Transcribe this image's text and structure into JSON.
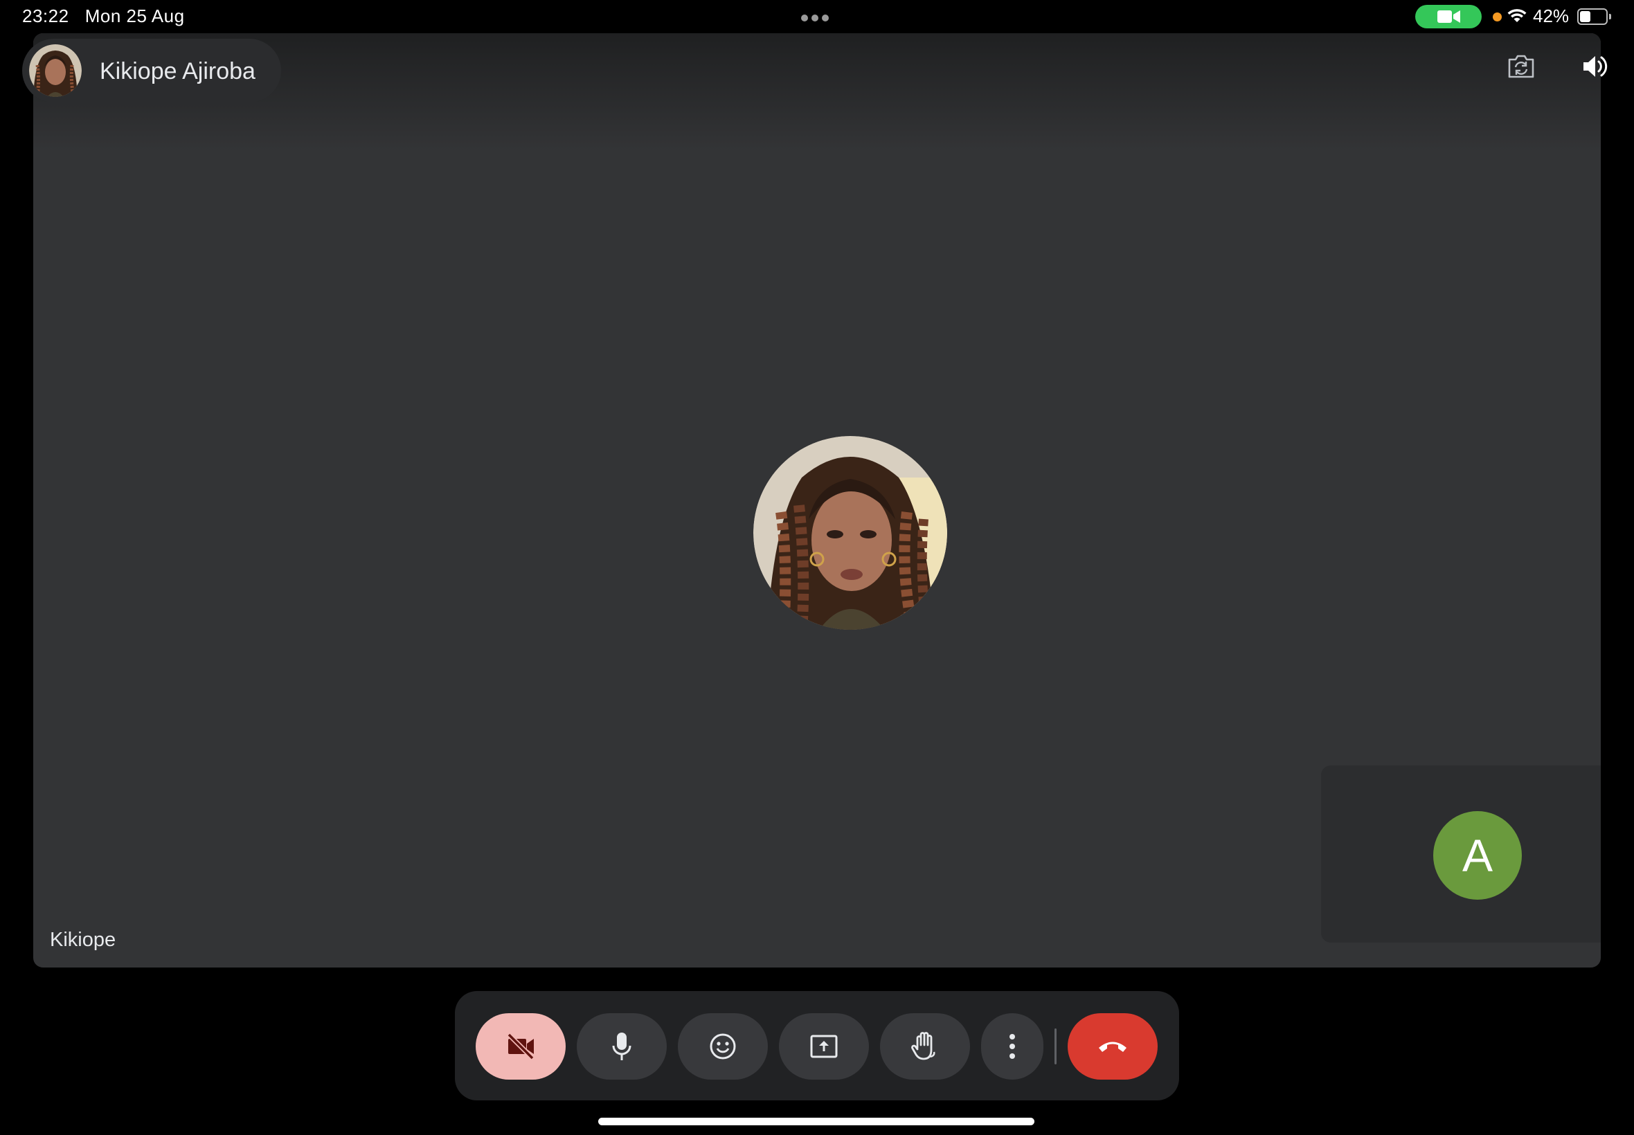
{
  "status_bar": {
    "time": "23:22",
    "date": "Mon 25 Aug",
    "battery_percent": "42%",
    "battery_level": 0.42,
    "camera_indicator_icon": "video-camera-icon",
    "wifi_icon": "wifi-icon"
  },
  "header": {
    "caller_name": "Kikiope Ajiroba",
    "switch_camera_icon": "switch-camera-icon",
    "speaker_icon": "speaker-icon"
  },
  "main_tile": {
    "participant_label": "Kikiope"
  },
  "self_tile": {
    "initial": "A",
    "avatar_color": "#6a9a3d"
  },
  "controls": {
    "camera_off_icon": "video-off-icon",
    "mic_icon": "microphone-icon",
    "reactions_icon": "emoji-icon",
    "present_icon": "present-screen-icon",
    "raise_hand_icon": "raise-hand-icon",
    "more_icon": "more-vert-icon",
    "end_call_icon": "hang-up-icon"
  },
  "colors": {
    "stage_bg": "#333436",
    "camera_off_button": "#f2b8b5",
    "end_call_button": "#d93a2f",
    "status_green": "#34c759"
  }
}
